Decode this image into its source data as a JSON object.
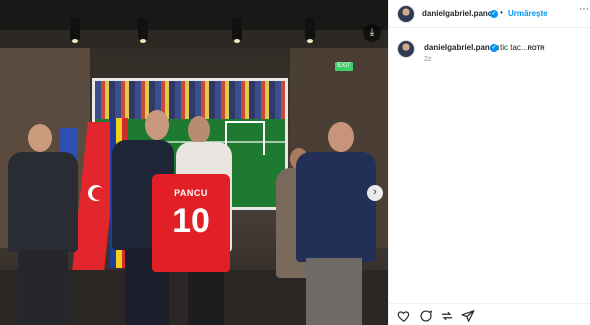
{
  "post": {
    "username": "danielgabriel.pancu",
    "follow_label": "Urmărește",
    "separator": "•",
    "caption": "tic tac...",
    "caption_extra": "ROTR",
    "time_ago": "2z",
    "more_glyph": "⋯"
  },
  "photo": {
    "jersey_name": "PANCU",
    "jersey_number": "10",
    "exit_sign": "EXIT"
  },
  "icons": {
    "download": "download-icon",
    "next": "chevron-right-icon",
    "like": "heart-icon",
    "comment": "comment-icon",
    "repost": "repost-icon",
    "share": "share-icon",
    "verified": "verified-badge-icon"
  },
  "colors": {
    "accent": "#0095f6",
    "text": "#262626",
    "muted": "#8e8e8e",
    "jersey": "#e21f26"
  }
}
